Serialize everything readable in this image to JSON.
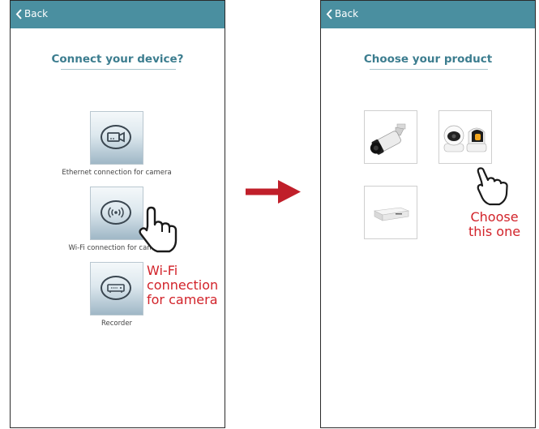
{
  "left_screen": {
    "back_label": "Back",
    "title": "Connect your device?",
    "options": [
      {
        "label": "Ethernet connection for camera",
        "icon": "ethernet-camera-icon"
      },
      {
        "label": "Wi-Fi connection for camera",
        "icon": "wifi-icon"
      },
      {
        "label": "Recorder",
        "icon": "recorder-icon"
      }
    ],
    "annotation": [
      "Wi-Fi",
      "connection",
      "for camera"
    ]
  },
  "right_screen": {
    "back_label": "Back",
    "title": "Choose your product",
    "products": [
      {
        "icon": "bullet-camera-icon"
      },
      {
        "icon": "pan-tilt-camera-icon"
      },
      {
        "icon": "recorder-box-icon"
      }
    ],
    "annotation": [
      "Choose",
      "this one"
    ]
  },
  "colors": {
    "topbar": "#4a8fa0",
    "title": "#3c7d8f",
    "annotation": "#d2232a"
  }
}
